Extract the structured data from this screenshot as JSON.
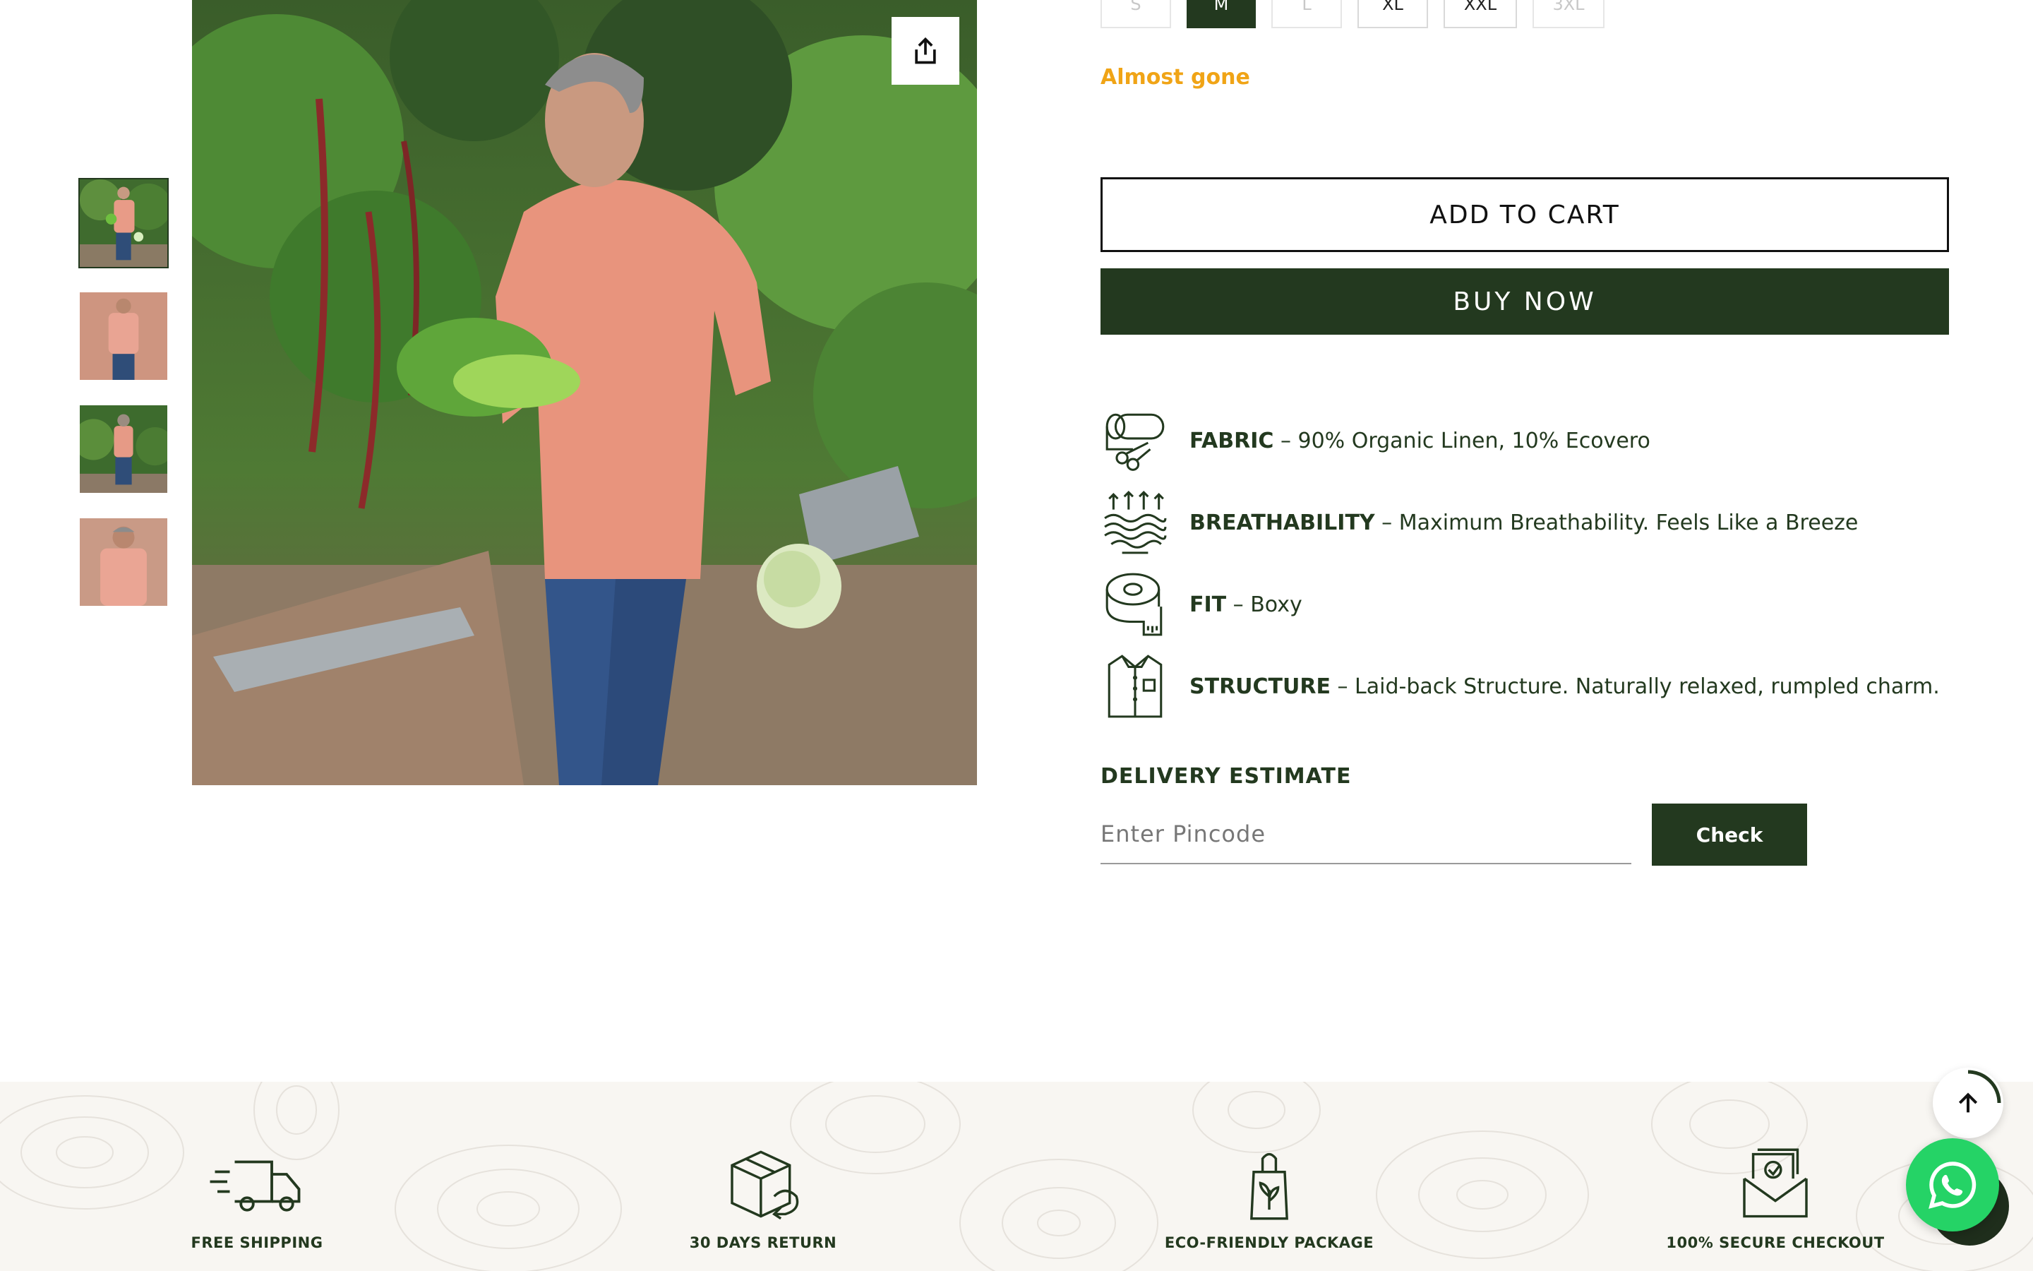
{
  "sizes": [
    {
      "label": "S",
      "state": "disabled"
    },
    {
      "label": "M",
      "state": "selected"
    },
    {
      "label": "L",
      "state": "disabled"
    },
    {
      "label": "XL",
      "state": "available"
    },
    {
      "label": "XXL",
      "state": "available"
    },
    {
      "label": "3XL",
      "state": "disabled"
    }
  ],
  "stock_status": "Almost gone",
  "actions": {
    "add_to_cart": "ADD TO CART",
    "buy_now": "BUY NOW"
  },
  "features": [
    {
      "icon": "fabric-roll-scissors-icon",
      "title": "FABRIC",
      "text": " – 90% Organic Linen, 10% Ecovero"
    },
    {
      "icon": "breathability-waves-icon",
      "title": "BREATHABILITY",
      "text": " – Maximum Breathability. Feels Like a Breeze"
    },
    {
      "icon": "measuring-tape-icon",
      "title": "FIT",
      "text": " – Boxy"
    },
    {
      "icon": "shirt-icon",
      "title": "STRUCTURE",
      "text": " – Laid-back Structure. Naturally relaxed, rumpled charm."
    }
  ],
  "delivery": {
    "title": "DELIVERY ESTIMATE",
    "placeholder": "Enter Pincode",
    "check_label": "Check"
  },
  "usps": [
    {
      "icon": "delivery-truck-icon",
      "label": "FREE SHIPPING"
    },
    {
      "icon": "return-box-icon",
      "label": "30 DAYS RETURN"
    },
    {
      "icon": "eco-bag-icon",
      "label": "ECO-FRIENDLY PACKAGE"
    },
    {
      "icon": "secure-envelope-icon",
      "label": "100% SECURE CHECKOUT"
    }
  ],
  "colors": {
    "brand_green": "#23391f",
    "stock_orange": "#f0a416",
    "whatsapp_green": "#25d366",
    "band_bg": "#f8f6f2"
  },
  "thumbnails": [
    {
      "name": "front-garden-vegetables"
    },
    {
      "name": "front-standing"
    },
    {
      "name": "back-view-garden"
    },
    {
      "name": "front-portrait"
    }
  ]
}
